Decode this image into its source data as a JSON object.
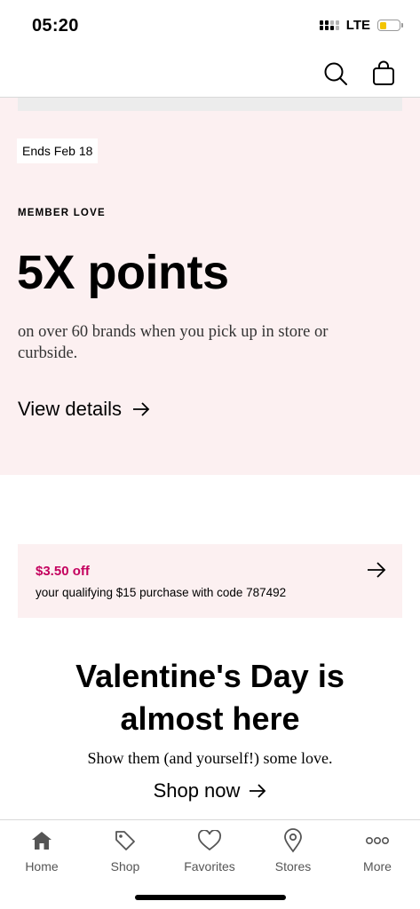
{
  "status_bar": {
    "time": "05:20",
    "network": "LTE",
    "battery_level": 0.35,
    "battery_color": "#f3c400"
  },
  "top_bar": {
    "icons": [
      "search-icon",
      "shopping-bag-icon"
    ]
  },
  "hero": {
    "badge": "Ends Feb 18",
    "eyebrow": "MEMBER LOVE",
    "headline": "5X points",
    "description": "on over 60 brands when you pick up in store or curbside.",
    "cta": "View details",
    "background": "#fcf0f1"
  },
  "coupon": {
    "amount": "$3.50 off",
    "description": "your qualifying $15 purchase with code 787492",
    "accent": "#c4005e"
  },
  "valentine": {
    "title_line1": "Valentine's Day is",
    "title_line2": "almost here",
    "subtitle": "Show them (and yourself!) some love.",
    "cta": "Shop now"
  },
  "tab_bar": {
    "items": [
      {
        "label": "Home",
        "icon": "home-icon"
      },
      {
        "label": "Shop",
        "icon": "tag-icon"
      },
      {
        "label": "Favorites",
        "icon": "heart-icon"
      },
      {
        "label": "Stores",
        "icon": "location-pin-icon"
      },
      {
        "label": "More",
        "icon": "more-dots-icon"
      }
    ]
  }
}
